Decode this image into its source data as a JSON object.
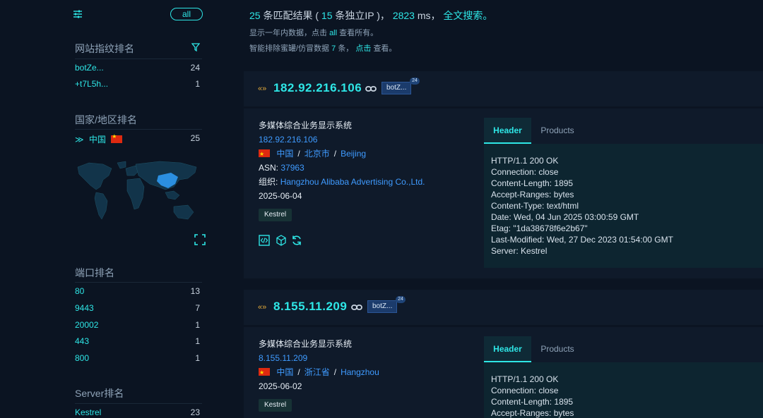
{
  "sidebar": {
    "all_label": "all",
    "fingerprint": {
      "title": "网站指纹排名",
      "items": [
        {
          "name": "botZe...",
          "count": "24"
        },
        {
          "name": "+t7L5h...",
          "count": "1"
        }
      ]
    },
    "country": {
      "title": "国家/地区排名",
      "items": [
        {
          "name": "中国",
          "count": "25"
        }
      ]
    },
    "ports": {
      "title": "端口排名",
      "items": [
        {
          "name": "80",
          "count": "13"
        },
        {
          "name": "9443",
          "count": "7"
        },
        {
          "name": "20002",
          "count": "1"
        },
        {
          "name": "443",
          "count": "1"
        },
        {
          "name": "800",
          "count": "1"
        }
      ]
    },
    "server": {
      "title": "Server排名",
      "items": [
        {
          "name": "Kestrel",
          "count": "23"
        }
      ]
    }
  },
  "summary": {
    "results_count": "25",
    "results_label": "条匹配结果 (",
    "unique_ip_count": "15",
    "unique_ip_label": "条独立IP )，",
    "time_value": "2823",
    "time_unit": "ms，",
    "fulltext_link": "全文搜索。",
    "line2_prefix": "显示一年内数据，点击",
    "line2_all": "all",
    "line2_suffix": "查看所有。",
    "line3_prefix": "智能排除蜜罐/仿冒数据",
    "line3_count": "7",
    "line3_mid": "条，",
    "line3_click": "点击",
    "line3_suffix": "查看。"
  },
  "results": [
    {
      "ip": "182.92.216.106",
      "tag": "botZ...",
      "tag_count": "24",
      "title": "多媒体综合业务显示系统",
      "ip_link": "182.92.216.106",
      "country": "中国",
      "province": "北京市",
      "city": "Beijing",
      "asn_label": "ASN:",
      "asn": "37963",
      "org_label": "组织:",
      "org": "Hangzhou Alibaba Advertising Co.,Ltd.",
      "date": "2025-06-04",
      "server_tag": "Kestrel",
      "tabs": [
        "Header",
        "Products"
      ],
      "header_lines": [
        "HTTP/1.1 200 OK",
        "Connection: close",
        "Content-Length: 1895",
        "Accept-Ranges: bytes",
        "Content-Type: text/html",
        "Date: Wed, 04 Jun 2025 03:00:59 GMT",
        "Etag: \"1da38678f6e2b67\"",
        "Last-Modified: Wed, 27 Dec 2023 01:54:00 GMT",
        "Server: Kestrel"
      ]
    },
    {
      "ip": "8.155.11.209",
      "tag": "botZ...",
      "tag_count": "24",
      "title": "多媒体综合业务显示系统",
      "ip_link": "8.155.11.209",
      "country": "中国",
      "province": "浙江省",
      "city": "Hangzhou",
      "date": "2025-06-02",
      "server_tag": "Kestrel",
      "tabs": [
        "Header",
        "Products"
      ],
      "header_lines": [
        "HTTP/1.1 200 OK",
        "Connection: close",
        "Content-Length: 1895",
        "Accept-Ranges: bytes"
      ]
    }
  ],
  "colors": {
    "accent": "#2ee6e6",
    "link": "#3f9bff",
    "background": "#0b1422",
    "card": "#0f1a2a"
  }
}
